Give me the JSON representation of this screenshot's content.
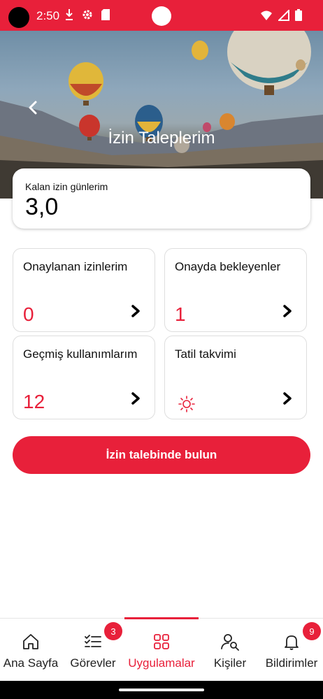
{
  "status_bar": {
    "time": "2:50",
    "color": "#e8203a",
    "icons_left": [
      "download-icon",
      "settings-icon",
      "sd-card-icon"
    ],
    "icons_right": [
      "wifi-icon",
      "signal-icon",
      "battery-icon"
    ]
  },
  "header": {
    "title": "İzin Taleplerim",
    "back_icon": "chevron-left-icon",
    "background": "hot-air-balloons-photo"
  },
  "remaining": {
    "label": "Kalan izin günlerim",
    "value": "3,0"
  },
  "tiles": [
    {
      "title": "Onaylanan izinlerim",
      "value": "0"
    },
    {
      "title": "Onayda bekleyenler",
      "value": "1"
    },
    {
      "title": "Geçmiş kullanımlarım",
      "value": "12"
    },
    {
      "title": "Tatil takvimi",
      "icon": "sun-icon"
    }
  ],
  "cta": {
    "label": "İzin talebinde bulun"
  },
  "bottom_nav": {
    "items": [
      {
        "label": "Ana Sayfa",
        "icon": "home-icon"
      },
      {
        "label": "Görevler",
        "icon": "tasks-icon",
        "badge": "3"
      },
      {
        "label": "Uygulamalar",
        "icon": "apps-grid-icon",
        "active": true
      },
      {
        "label": "Kişiler",
        "icon": "people-search-icon"
      },
      {
        "label": "Bildirimler",
        "icon": "bell-icon",
        "badge": "9"
      }
    ]
  },
  "colors": {
    "accent": "#e8203a"
  }
}
